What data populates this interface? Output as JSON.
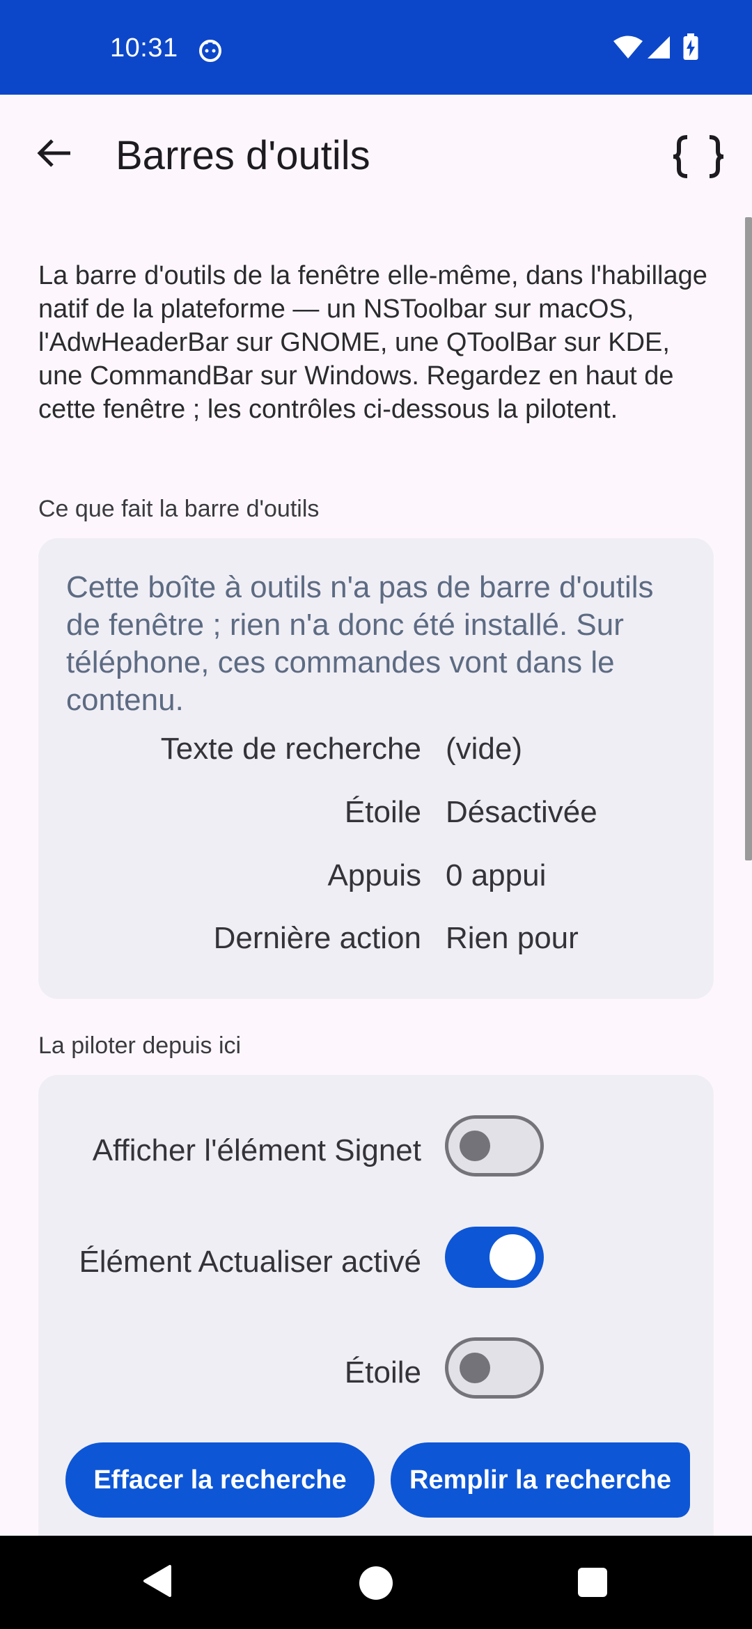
{
  "status_bar": {
    "time": "10:31",
    "app_icon": "cat-face-icon",
    "wifi_icon": "wifi-icon",
    "signal_icon": "cell-signal-icon",
    "battery_icon": "battery-charging-icon",
    "background": "#0d47c9"
  },
  "app_bar": {
    "title": "Barres d'outils",
    "back_icon": "arrow-back-icon",
    "action_icon": "braces-icon",
    "action_glyph": "{ }"
  },
  "intro_text": "La barre d'outils de la fenêtre elle-même, dans l'habillage natif de la plateforme — un NSToolbar sur macOS, l'AdwHeaderBar sur GNOME, une QToolBar sur KDE, une CommandBar sur Windows. Regardez en haut de cette fenêtre ; les contrôles ci-dessous la pilotent.",
  "status_section": {
    "label": "Ce que fait la barre d'outils",
    "note": "Cette boîte à outils n'a pas de barre d'outils de fenêtre ; rien n'a donc été installé. Sur téléphone, ces commandes vont dans le contenu.",
    "rows": [
      {
        "key": "Texte de recherche",
        "value": "(vide)"
      },
      {
        "key": "Étoile",
        "value": "Désactivée"
      },
      {
        "key": "Appuis",
        "value": "0 appui"
      },
      {
        "key": "Dernière action",
        "value": "Rien pour"
      }
    ]
  },
  "control_section": {
    "label": "La piloter depuis ici",
    "toggles": [
      {
        "label": "Afficher l'élément Signet",
        "on": false
      },
      {
        "label": "Élément Actualiser activé",
        "on": true
      },
      {
        "label": "Étoile",
        "on": false
      }
    ],
    "buttons": [
      {
        "label": "Effacer la recherche"
      },
      {
        "label": "Remplir la recherche"
      }
    ]
  },
  "nav_bar": {
    "back_icon": "nav-back-triangle-icon",
    "home_icon": "nav-home-circle-icon",
    "recents_icon": "nav-recents-square-icon"
  },
  "colors": {
    "accent": "#0d56d6",
    "card_background": "#f0eef5",
    "note_text": "#5c6b82",
    "page_background": "#fdf7fd"
  }
}
